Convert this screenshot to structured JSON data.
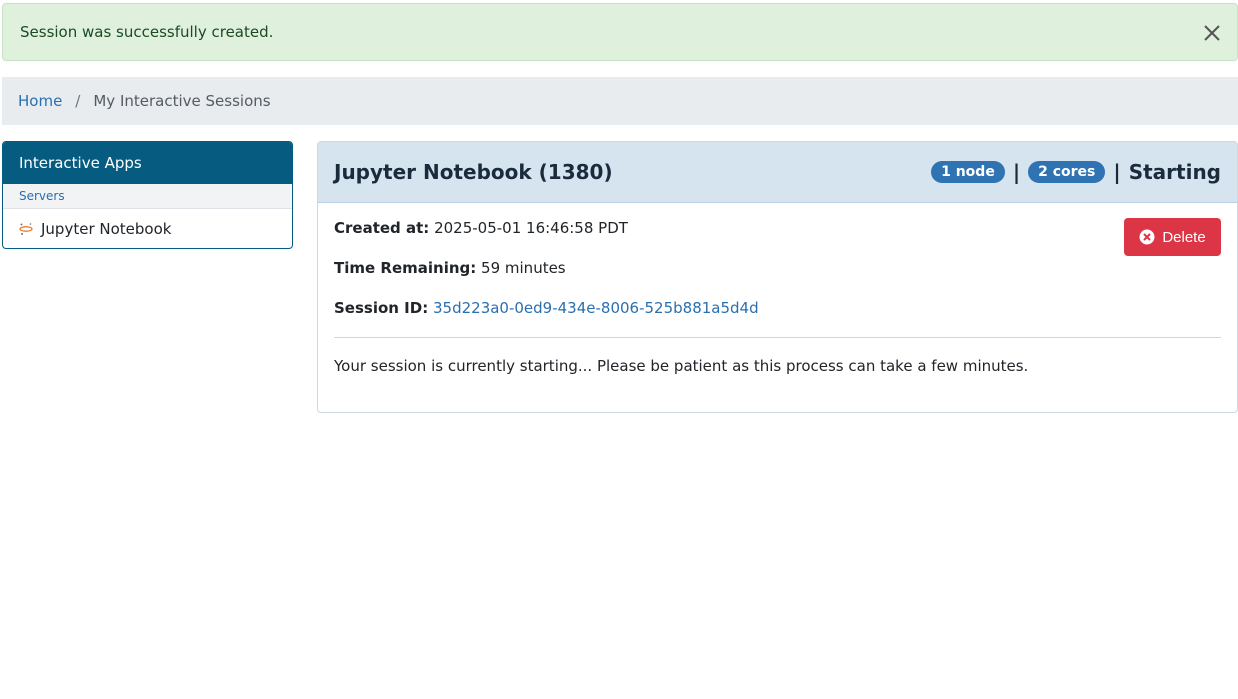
{
  "alert": {
    "message": "Session was successfully created.",
    "close_icon": "close-icon"
  },
  "breadcrumb": {
    "home": "Home",
    "separator": "/",
    "current": "My Interactive Sessions"
  },
  "sidebar": {
    "title": "Interactive Apps",
    "category": "Servers",
    "items": [
      {
        "label": "Jupyter Notebook",
        "icon": "jupyter-icon"
      }
    ]
  },
  "session": {
    "title": "Jupyter Notebook (1380)",
    "nodes_badge": "1 node",
    "cores_badge": "2 cores",
    "pipe": "|",
    "status": "Starting",
    "created_label": "Created at:",
    "created_value": "2025-05-01 16:46:58 PDT",
    "time_label": "Time Remaining:",
    "time_value": "59 minutes",
    "id_label": "Session ID:",
    "id_value": "35d223a0-0ed9-434e-8006-525b881a5d4d",
    "message": "Your session is currently starting... Please be patient as this process can take a few minutes.",
    "delete_label": "Delete"
  },
  "colors": {
    "alert_bg": "#dff0dd",
    "sidebar_header": "#065c80",
    "card_header": "#d6e4f0",
    "badge": "#2f73b2",
    "danger": "#dc3545",
    "link": "#2a6fb0"
  }
}
